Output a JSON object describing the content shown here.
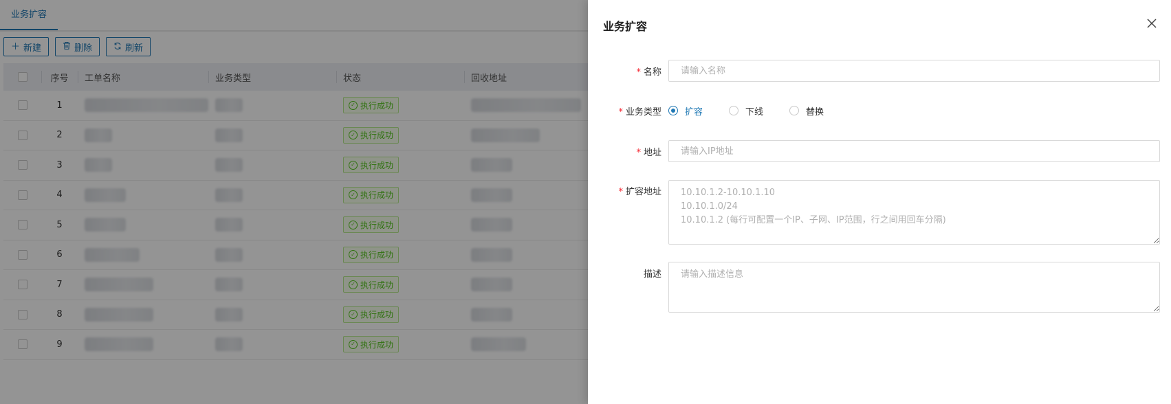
{
  "tabs": {
    "active": "业务扩容"
  },
  "toolbar": {
    "new_label": "新建",
    "delete_label": "删除",
    "refresh_label": "刷新"
  },
  "table": {
    "columns": [
      "序号",
      "工单名称",
      "业务类型",
      "状态",
      "回收地址"
    ],
    "rows": [
      {
        "index": "1",
        "status": "执行成功"
      },
      {
        "index": "2",
        "status": "执行成功"
      },
      {
        "index": "3",
        "status": "执行成功"
      },
      {
        "index": "4",
        "status": "执行成功"
      },
      {
        "index": "5",
        "status": "执行成功"
      },
      {
        "index": "6",
        "status": "执行成功"
      },
      {
        "index": "7",
        "status": "执行成功"
      },
      {
        "index": "8",
        "status": "执行成功"
      },
      {
        "index": "9",
        "status": "执行成功"
      }
    ]
  },
  "drawer": {
    "title": "业务扩容",
    "name": {
      "label": "名称",
      "placeholder": "请输入名称",
      "value": ""
    },
    "biz_type": {
      "label": "业务类型",
      "options": [
        "扩容",
        "下线",
        "替换"
      ],
      "selected": "扩容"
    },
    "address": {
      "label": "地址",
      "placeholder": "请输入IP地址",
      "value": ""
    },
    "expand_address": {
      "label": "扩容地址",
      "placeholder": "10.10.1.2-10.10.1.10\n10.10.1.0/24\n10.10.1.2 (每行可配置一个IP、子网、IP范围，行之间用回车分隔)",
      "value": ""
    },
    "description": {
      "label": "描述",
      "placeholder": "请输入描述信息",
      "value": ""
    }
  },
  "colors": {
    "accent": "#1f78b4",
    "success": "#52c41a",
    "required": "#f5222d"
  }
}
